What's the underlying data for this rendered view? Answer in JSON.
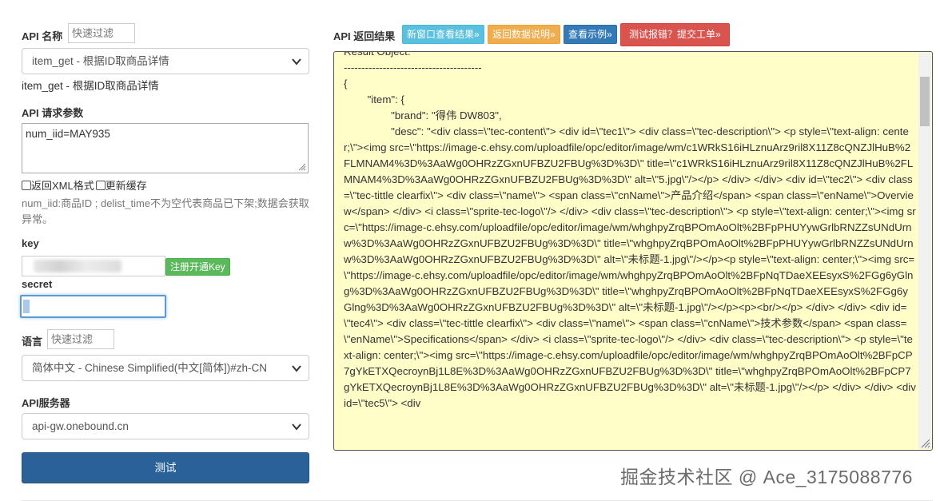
{
  "left": {
    "api_name_label": "API 名称",
    "filter_placeholder": "快速过滤",
    "api_select_value": "item_get - 根据ID取商品详情",
    "api_desc": "item_get - 根据ID取商品详情",
    "params_label": "API 请求参数",
    "params_value": "num_iid=MAY935",
    "xml_checkbox_label": "返回XML格式",
    "cache_checkbox_label": "更新缓存",
    "params_hint": "num_iid:商品ID ; delist_time不为空代表商品已下架;数据会获取异常。",
    "key_label": "key",
    "register_button": "注册开通Key",
    "secret_label": "secret",
    "lang_label": "语言",
    "lang_select_value": "简体中文 - Chinese Simplified(中文[简体])#zh-CN",
    "server_label": "API服务器",
    "server_select_value": "api-gw.onebound.cn",
    "test_button": "测试"
  },
  "right": {
    "result_label": "API 返回结果",
    "btn_new_window": "新窗口查看结果»",
    "btn_data_desc": "返回数据说明»",
    "btn_example": "查看示例»",
    "btn_report": "测试报错？提交工单»",
    "result_text": "Result Object:\n---------------------------------------\n{\n        \"item\": {\n                \"brand\": \"得伟 DW803\",\n                \"desc\": \"<div class=\\\"tec-content\\\"> <div id=\\\"tec1\\\"> <div class=\\\"tec-description\\\"> <p style=\\\"text-align: center;\\\"><img src=\\\"https://image-c.ehsy.com/uploadfile/opc/editor/image/wm/c1WRkS16iHLznuArz9ril8X11Z8cQNZJlHuB%2FLMNAM4%3D%3AaWg0OHRzZGxnUFBZU2FBUg%3D%3D\\\" title=\\\"c1WRkS16iHLznuArz9ril8X11Z8cQNZJlHuB%2FLMNAM4%3D%3AaWg0OHRzZGxnUFBZU2FBUg%3D%3D\\\" alt=\\\"5.jpg\\\"/></p> </div> </div> <div id=\\\"tec2\\\"> <div class=\\\"tec-tittle clearfix\\\"> <div class=\\\"name\\\"> <span class=\\\"cnName\\\">产品介绍</span> <span class=\\\"enName\\\">Overview</span> </div> <i class=\\\"sprite-tec-logo\\\"/> </div> <div class=\\\"tec-description\\\"> <p style=\\\"text-align: center;\\\"><img src=\\\"https://image-c.ehsy.com/uploadfile/opc/editor/image/wm/whghpyZrqBPOmAoOlt%2BFpPHUYywGrlbRNZZsUNdUrnw%3D%3AaWg0OHRzZGxnUFBZU2FBUg%3D%3D\\\" title=\\\"whghpyZrqBPOmAoOlt%2BFpPHUYywGrlbRNZZsUNdUrnw%3D%3AaWg0OHRzZGxnUFBZU2FBUg%3D%3D\\\" alt=\\\"未标题-1.jpg\\\"/></p><p style=\\\"text-align: center;\\\"><img src=\\\"https://image-c.ehsy.com/uploadfile/opc/editor/image/wm/whghpyZrqBPOmAoOlt%2BFpNqTDaeXEEsyxS%2FGg6yGlng%3D%3AaWg0OHRzZGxnUFBZU2FBUg%3D%3D\\\" title=\\\"whghpyZrqBPOmAoOlt%2BFpNqTDaeXEEsyxS%2FGg6yGlng%3D%3AaWg0OHRzZGxnUFBZU2FBUg%3D%3D\\\" alt=\\\"未标题-1.jpg\\\"/></p><p><br/></p> </div> </div> <div id=\\\"tec4\\\"> <div class=\\\"tec-tittle clearfix\\\"> <div class=\\\"name\\\"> <span class=\\\"cnName\\\">技术参数</span> <span class=\\\"enName\\\">Specifications</span> </div> <i class=\\\"sprite-tec-logo\\\"/> </div> <div class=\\\"tec-description\\\"> <p style=\\\"text-align: center;\\\"><img src=\\\"https://image-c.ehsy.com/uploadfile/opc/editor/image/wm/whghpyZrqBPOmAoOlt%2BFpCP7gYkETXQecroynBj1L8E%3D%3AaWg0OHRzZGxnUFBZU2FBUg%3D%3D\\\" title=\\\"whghpyZrqBPOmAoOlt%2BFpCP7gYkETXQecroynBj1L8E%3D%3AaWg0OHRzZGxnUFBZU2FBUg%3D%3D\\\" alt=\\\"未标题-1.jpg\\\"/></p> </div> </div> <div id=\\\"tec5\\\"> <div"
  },
  "watermark": "掘金技术社区 @ Ace_3175088776",
  "colors": {
    "btn_new_window": "#5bc0de",
    "btn_data_desc": "#f0ad4e",
    "btn_example": "#337ab7",
    "btn_report": "#d9534f",
    "btn_register": "#5cb85c",
    "btn_test": "#2b6199",
    "result_bg": "#fffdc8"
  }
}
